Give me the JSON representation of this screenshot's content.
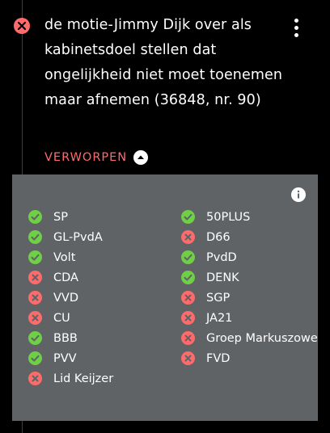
{
  "motion": {
    "title": "de motie-Jimmy Dijk over als kabinetsdoel stellen dat ongelijkheid niet moet toenemen maar afnemen (36848, nr. 90)",
    "result": "VERWORPEN",
    "status_icon": "x-circle-icon"
  },
  "colors": {
    "background": "#000000",
    "panel": "#5f6366",
    "for": "#6fcf46",
    "against": "#ff6b6b"
  },
  "votes": {
    "left": [
      {
        "party": "SP",
        "vote": "for"
      },
      {
        "party": "GL-PvdA",
        "vote": "for"
      },
      {
        "party": "Volt",
        "vote": "for"
      },
      {
        "party": "CDA",
        "vote": "against"
      },
      {
        "party": "VVD",
        "vote": "against"
      },
      {
        "party": "CU",
        "vote": "against"
      },
      {
        "party": "BBB",
        "vote": "for"
      },
      {
        "party": "PVV",
        "vote": "for"
      },
      {
        "party": "Lid Keijzer",
        "vote": "against"
      }
    ],
    "right": [
      {
        "party": "50PLUS",
        "vote": "for"
      },
      {
        "party": "D66",
        "vote": "against"
      },
      {
        "party": "PvdD",
        "vote": "for"
      },
      {
        "party": "DENK",
        "vote": "for"
      },
      {
        "party": "SGP",
        "vote": "against"
      },
      {
        "party": "JA21",
        "vote": "against"
      },
      {
        "party": "Groep Markuszowe",
        "vote": "against"
      },
      {
        "party": "FVD",
        "vote": "against"
      }
    ]
  }
}
